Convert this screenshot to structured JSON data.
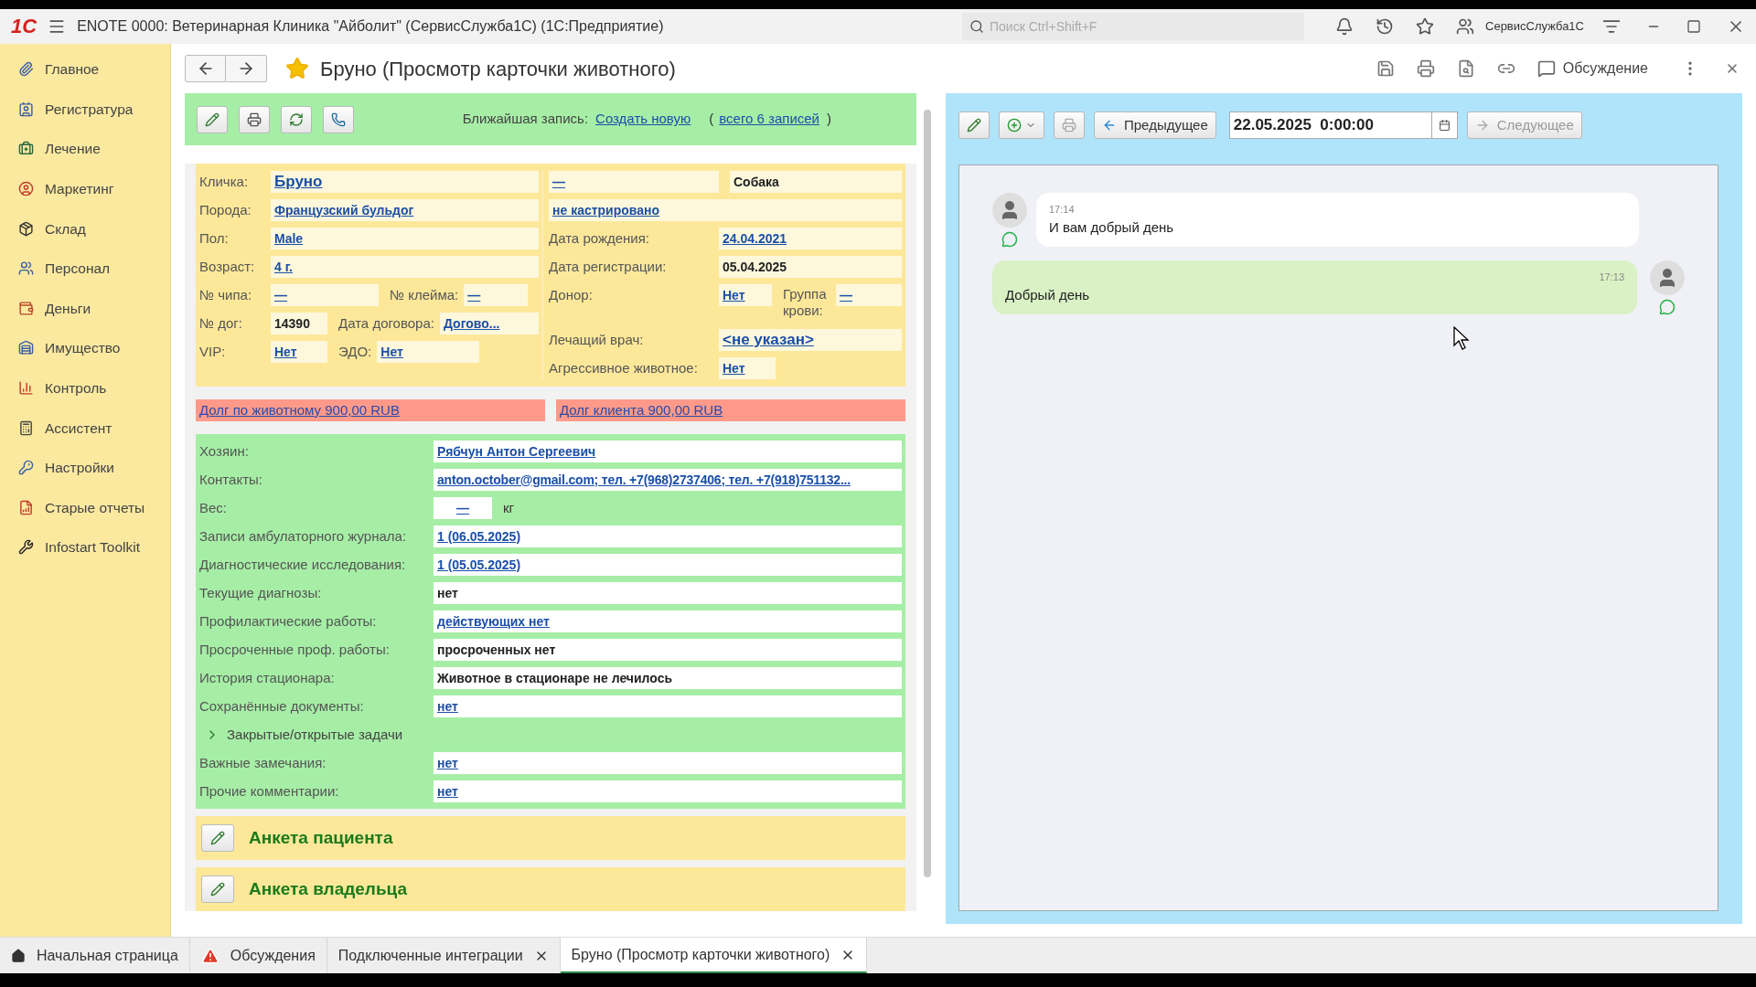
{
  "window": {
    "logo": "1С",
    "title": "ENOTE 0000: Ветеринарная Клиника \"Айболит\" (СервисСлужба1С)  (1С:Предприятие)",
    "search_placeholder": "Поиск Ctrl+Shift+F",
    "user": "СервисСлужба1С"
  },
  "sidebar": {
    "items": [
      {
        "label": "Главное"
      },
      {
        "label": "Регистратура"
      },
      {
        "label": "Лечение"
      },
      {
        "label": "Маркетинг"
      },
      {
        "label": "Склад"
      },
      {
        "label": "Персонал"
      },
      {
        "label": "Деньги"
      },
      {
        "label": "Имущество"
      },
      {
        "label": "Контроль"
      },
      {
        "label": "Ассистент"
      },
      {
        "label": "Настройки"
      },
      {
        "label": "Старые отчеты"
      },
      {
        "label": "Infostart Toolkit"
      }
    ]
  },
  "header": {
    "title": "Бруно (Просмотр карточки животного)",
    "favorite": true,
    "discussion": "Обсуждение"
  },
  "form_toolbar": {
    "nearest_label": "Ближайшая запись:",
    "create_link": "Создать новую",
    "paren_open": "(",
    "all_link": "всего 6 записей",
    "paren_close": ")"
  },
  "animal_left": [
    [
      {
        "label": "Кличка:",
        "value": "Бруно",
        "link": true,
        "large": true
      }
    ],
    [
      {
        "label": "Порода:",
        "value": "Французский бульдог",
        "link": true
      }
    ],
    [
      {
        "label": "Пол:",
        "value": "Male",
        "link": true
      }
    ],
    [
      {
        "label": "Возраст:",
        "value": "4 г.",
        "link": true
      }
    ],
    [
      {
        "label": "№ чипа:",
        "value": "—",
        "link": true
      },
      {
        "label": "№ клейма:",
        "value": "—",
        "link": true
      }
    ],
    [
      {
        "label": "№ дог:",
        "value": "14390",
        "link": false
      },
      {
        "label": "Дата договора:",
        "value": "Догово...",
        "link": true
      }
    ],
    [
      {
        "label": "VIP:",
        "value": "Нет",
        "link": true
      },
      {
        "label": "ЭДО:",
        "value": "Нет",
        "link": true
      }
    ]
  ],
  "animal_right": [
    [
      {
        "value": "—",
        "link": true
      },
      {
        "value": "Собака",
        "link": false
      }
    ],
    [
      {
        "value": "не кастрировано",
        "link": true
      }
    ],
    [
      {
        "label": "Дата рождения:",
        "value": "24.04.2021",
        "link": true
      }
    ],
    [
      {
        "label": "Дата регистрации:",
        "value": "05.04.2025",
        "link": false
      }
    ],
    [
      {
        "label": "Донор:",
        "value": "Нет",
        "link": true
      },
      {
        "label": "Группа крови:",
        "value": "—",
        "link": true
      }
    ],
    [
      {
        "label": "Лечащий врач:",
        "value": "<не указан>",
        "link": true,
        "large": true
      }
    ],
    [
      {
        "label": "Агрессивное животное:",
        "value": "Нет",
        "link": true
      }
    ]
  ],
  "debts": [
    "Долг по животному 900,00 RUB",
    "Долг клиента 900,00 RUB"
  ],
  "owner_rows": [
    {
      "kind": "field",
      "label": "Хозяин:",
      "value": "Рябчун Антон Сергеевич",
      "link": true
    },
    {
      "kind": "field",
      "label": "Контакты:",
      "value": "anton.october@gmail.com; тел. +7(968)2737406; тел. +7(918)751132...",
      "link": true
    },
    {
      "kind": "weight",
      "label": "Вес:",
      "value": "—",
      "unit": "кг",
      "link": true
    },
    {
      "kind": "field",
      "label": "Записи амбулаторного журнала:",
      "value": "1 (06.05.2025)",
      "link": true
    },
    {
      "kind": "field",
      "label": "Диагностические исследования:",
      "value": "1 (05.05.2025)",
      "link": true
    },
    {
      "kind": "field",
      "label": "Текущие диагнозы:",
      "value": "нет",
      "link": false
    },
    {
      "kind": "field",
      "label": "Профилактические работы:",
      "value": "действующих нет",
      "link": true
    },
    {
      "kind": "field",
      "label": "Просроченные проф. работы:",
      "value": "просроченных нет",
      "link": false
    },
    {
      "kind": "field",
      "label": "История стационара:",
      "value": "Животное в стационаре не лечилось",
      "link": false
    },
    {
      "kind": "field",
      "label": "Сохранённые документы:",
      "value": "нет",
      "link": true
    },
    {
      "kind": "group",
      "label": "Закрытые/открытые задачи",
      "expanded": false
    },
    {
      "kind": "field",
      "label": "Важные замечания:",
      "value": "нет",
      "link": true
    },
    {
      "kind": "field",
      "label": "Прочие комментарии:",
      "value": "нет",
      "link": true
    }
  ],
  "sections": [
    "Анкета пациента",
    "Анкета владельца"
  ],
  "chat_toolbar": {
    "previous": "Предыдущее",
    "date": "22.05.2025  0:00:00",
    "next": "Следующее",
    "next_disabled": true
  },
  "messages": [
    {
      "kind": "incoming",
      "time": "17:14",
      "text": "И вам добрый день"
    },
    {
      "kind": "outgoing",
      "time": "17:13",
      "text": "Добрый день"
    }
  ],
  "tabs": [
    {
      "label": "Начальная страница",
      "closable": false,
      "selected": false
    },
    {
      "label": "Обсуждения",
      "closable": false,
      "selected": false
    },
    {
      "label": "Подключенные интеграции",
      "closable": true,
      "selected": false
    },
    {
      "label": "Бруно (Просмотр карточки животного)",
      "closable": true,
      "selected": true
    }
  ]
}
